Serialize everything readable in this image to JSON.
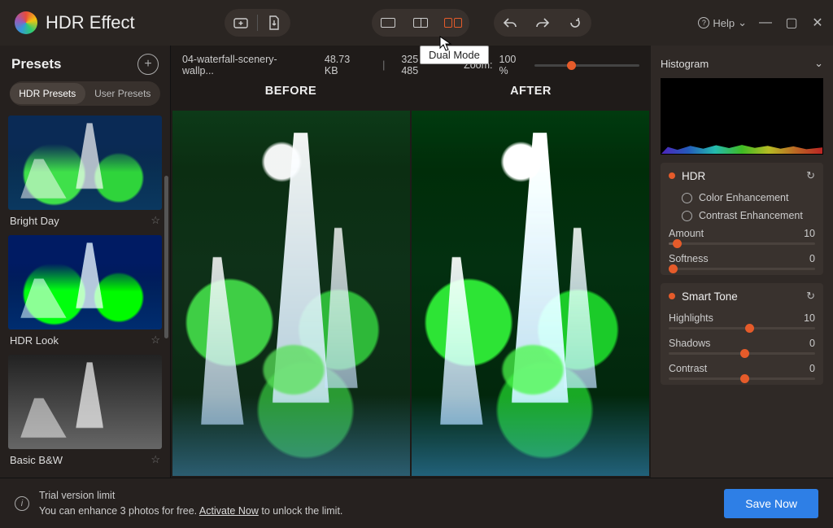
{
  "app": {
    "title": "HDR Effect"
  },
  "help": {
    "label": "Help"
  },
  "tooltip": {
    "view_dual": "Dual Mode"
  },
  "file": {
    "name": "04-waterfall-scenery-wallp...",
    "size": "48.73 KB",
    "dims": "325 X 485"
  },
  "zoom": {
    "label": "Zoom:",
    "value": "100 %"
  },
  "compare": {
    "before": "BEFORE",
    "after": "AFTER"
  },
  "presets": {
    "title": "Presets",
    "tabs": {
      "hdr": "HDR Presets",
      "user": "User Presets"
    },
    "items": [
      {
        "label": "Bright Day"
      },
      {
        "label": "HDR Look"
      },
      {
        "label": "Basic B&W"
      }
    ]
  },
  "panel": {
    "histogram": "Histogram",
    "hdr": {
      "title": "HDR",
      "opt_color": "Color Enhancement",
      "opt_contrast": "Contrast Enhancement",
      "amount_label": "Amount",
      "amount_value": "10",
      "softness_label": "Softness",
      "softness_value": "0"
    },
    "smart": {
      "title": "Smart Tone",
      "highlights_label": "Highlights",
      "highlights_value": "10",
      "shadows_label": "Shadows",
      "shadows_value": "0",
      "contrast_label": "Contrast",
      "contrast_value": "0"
    }
  },
  "trial": {
    "title": "Trial version limit",
    "body_pre": "You can enhance 3 photos for free. ",
    "activate": "Activate Now",
    "body_post": " to unlock the limit."
  },
  "actions": {
    "save": "Save Now"
  }
}
